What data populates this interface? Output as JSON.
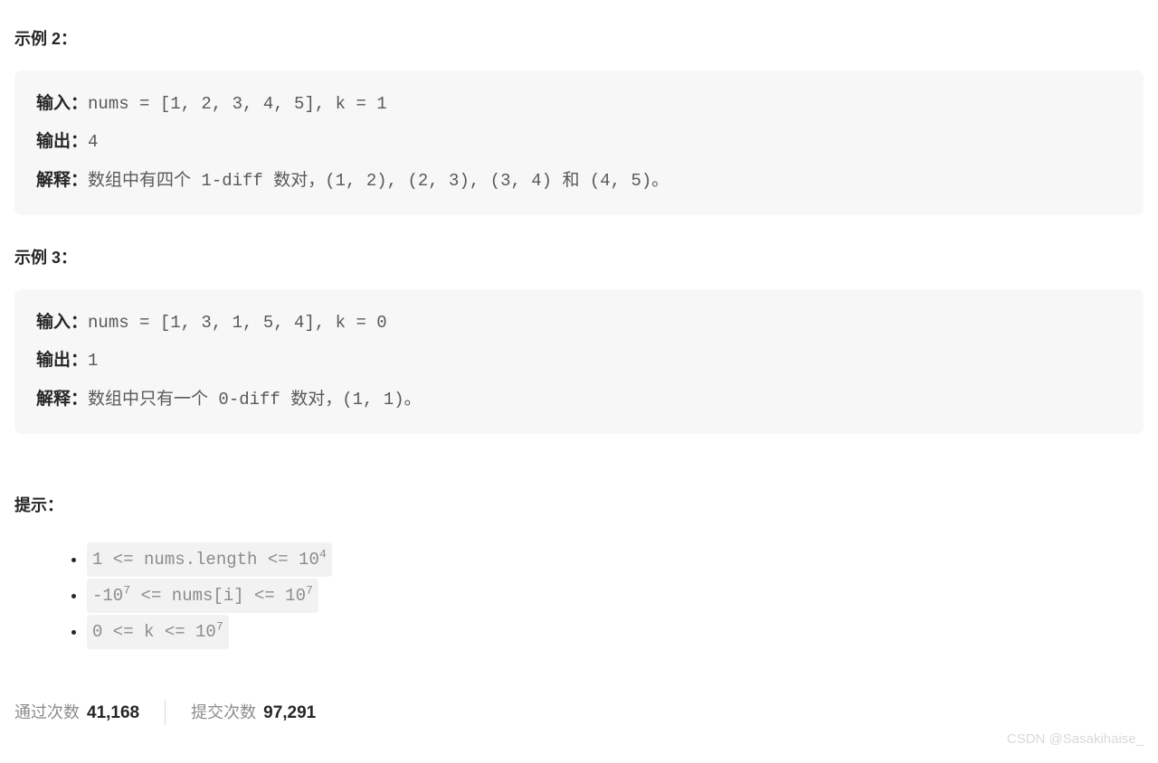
{
  "example2": {
    "title": "示例 2：",
    "input_label": "输入：",
    "input_value": "nums = [1, 2, 3, 4, 5], k = 1",
    "output_label": "输出：",
    "output_value": "4",
    "explain_label": "解释：",
    "explain_value": "数组中有四个 1-diff 数对，(1, 2), (2, 3), (3, 4) 和 (4, 5)。"
  },
  "example3": {
    "title": "示例 3：",
    "input_label": "输入：",
    "input_value": "nums = [1, 3, 1, 5, 4], k = 0",
    "output_label": "输出：",
    "output_value": "1",
    "explain_label": "解释：",
    "explain_value": "数组中只有一个 0-diff 数对，(1, 1)。"
  },
  "hints": {
    "title": "提示：",
    "items": [
      {
        "pre": "1 <= nums.length <= 10",
        "sup": "4",
        "post": ""
      },
      {
        "pre": "-10",
        "sup": "7",
        "mid": " <= nums[i] <= 10",
        "sup2": "7",
        "post": ""
      },
      {
        "pre": "0 <= k <= 10",
        "sup": "7",
        "post": ""
      }
    ]
  },
  "stats": {
    "pass_label": "通过次数",
    "pass_value": "41,168",
    "submit_label": "提交次数",
    "submit_value": "97,291"
  },
  "watermark": "CSDN @Sasakihaise_"
}
